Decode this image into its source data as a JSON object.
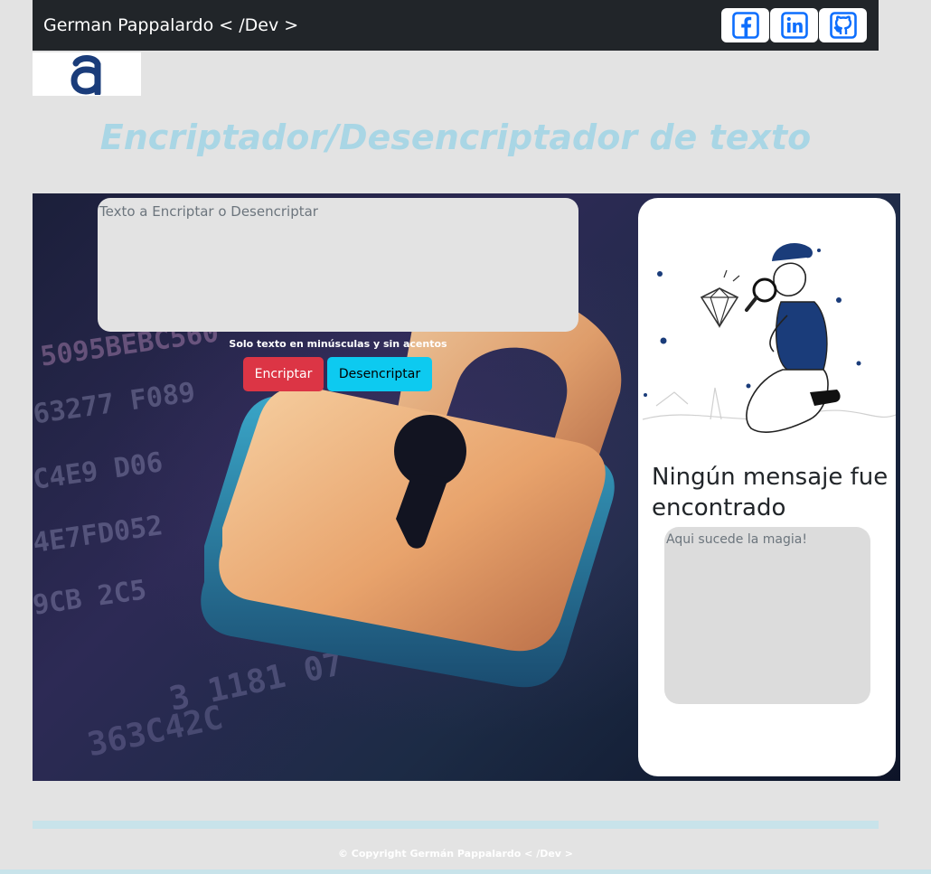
{
  "navbar": {
    "brand": "German Pappalardo < /Dev >",
    "social": [
      {
        "name": "Facebook",
        "icon": "facebook-icon"
      },
      {
        "name": "LinkedIn",
        "icon": "linkedin-icon"
      },
      {
        "name": "GitHub",
        "icon": "github-icon"
      }
    ]
  },
  "logo": {
    "glyph": "a",
    "icon": "alura-logo"
  },
  "title": "Encriptador/Desencriptador de texto",
  "main": {
    "input_placeholder": "Texto a Encriptar o Desencriptar",
    "hint": "Solo texto en minúsculas y sin acentos",
    "encrypt_label": "Encriptar",
    "decrypt_label": "Desencriptar"
  },
  "result": {
    "title": "Ningún mensaje fue encontrado",
    "output_placeholder": "Aqui sucede la magia!"
  },
  "footer": {
    "text": "© Copyright Germán Pappalardo < /Dev >"
  },
  "colors": {
    "navbar": "#212529",
    "title": "#a9d6e5",
    "encrypt": "#dc3545",
    "decrypt": "#0dcaf0",
    "brand_blue": "#1a3c7a"
  }
}
